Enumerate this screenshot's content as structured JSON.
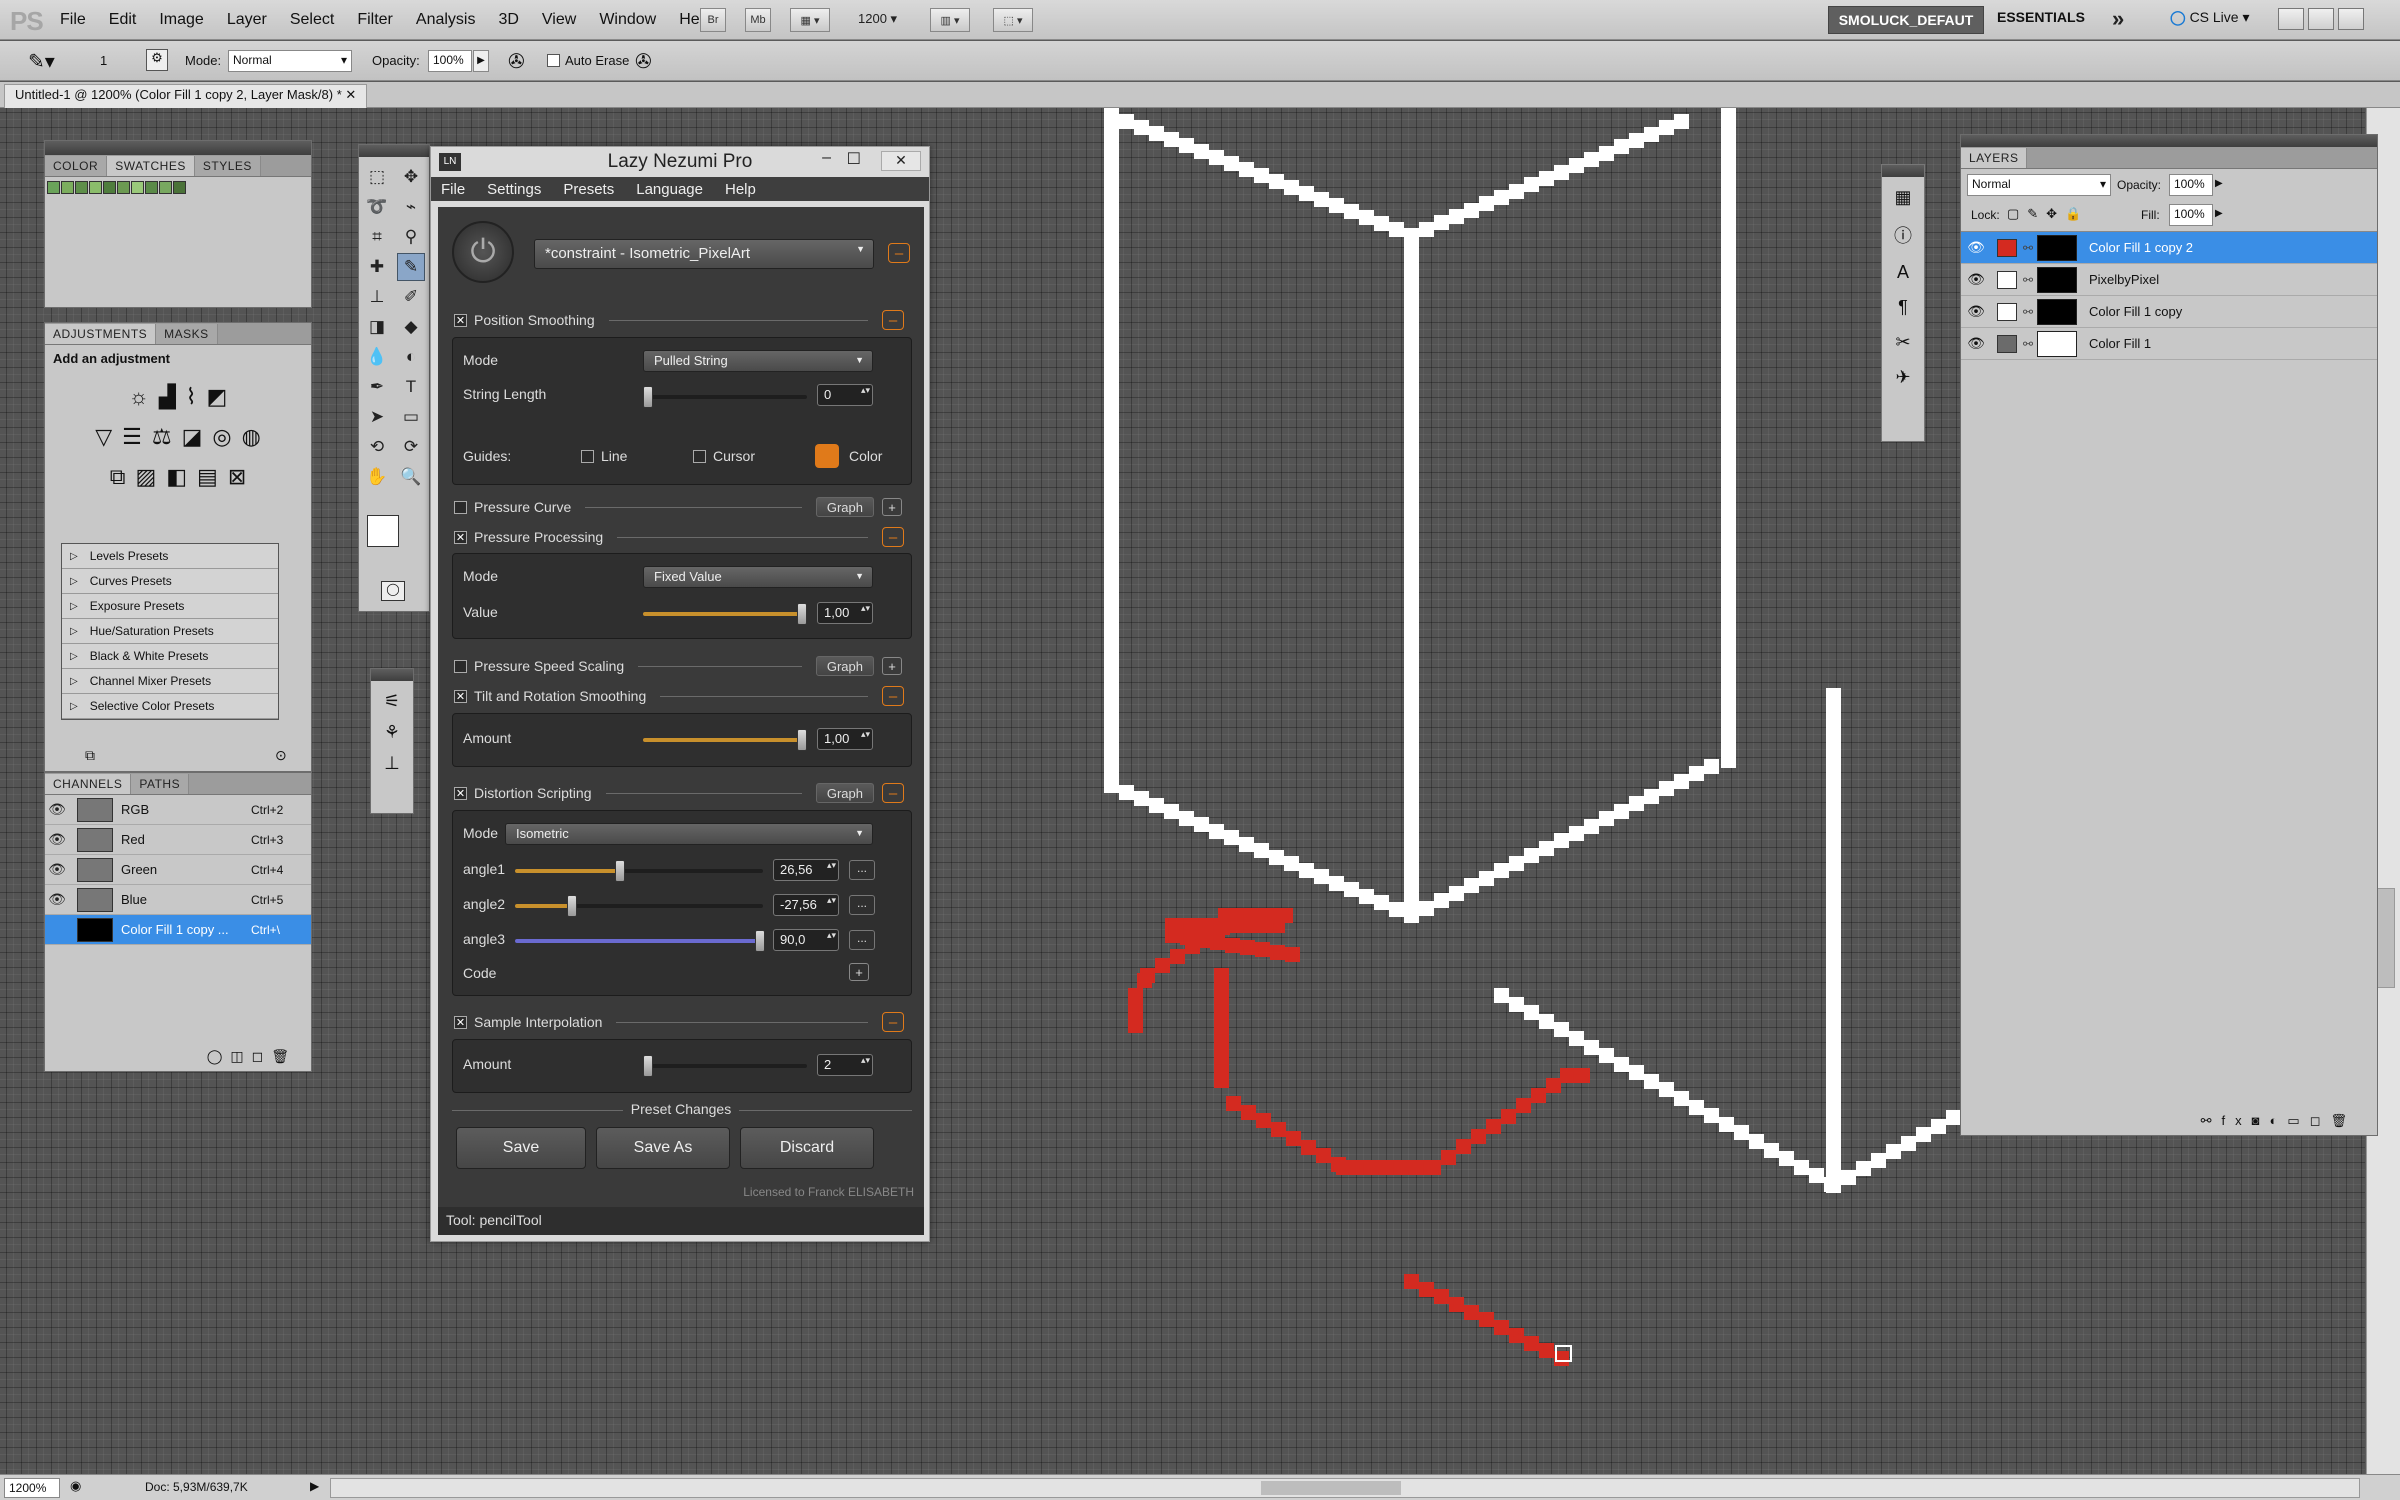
{
  "app": {
    "logo": "PS"
  },
  "menu": [
    "File",
    "Edit",
    "Image",
    "Layer",
    "Select",
    "Filter",
    "Analysis",
    "3D",
    "View",
    "Window",
    "Help"
  ],
  "appbar": {
    "bridge": "Br",
    "minibridge": "Mb",
    "zoom": "1200",
    "workspace_active": "SMOLUCK_DEFAUT",
    "workspace": "ESSENTIALS",
    "more": "»",
    "cslive": "CS Live"
  },
  "options": {
    "brush_size": "1",
    "mode_label": "Mode:",
    "mode_value": "Normal",
    "opacity_label": "Opacity:",
    "opacity_value": "100%",
    "auto_erase": "Auto Erase"
  },
  "document": {
    "tab": "Untitled-1 @ 1200% (Color Fill 1 copy 2, Layer Mask/8) *",
    "zoom_status": "1200%",
    "doc_status": "Doc: 5,93M/639,7K"
  },
  "color_panel": {
    "tabs": [
      "COLOR",
      "SWATCHES",
      "STYLES"
    ],
    "swatches": [
      "#6aa35a",
      "#7cae5e",
      "#5e8f4a",
      "#8bbd6b",
      "#4f7d3d",
      "#6c9a52",
      "#9ac97a",
      "#5a8a48",
      "#78a860",
      "#4a7238"
    ]
  },
  "adjustments": {
    "tabs": [
      "ADJUSTMENTS",
      "MASKS"
    ],
    "heading": "Add an adjustment",
    "presets": [
      "Levels Presets",
      "Curves Presets",
      "Exposure Presets",
      "Hue/Saturation Presets",
      "Black & White Presets",
      "Channel Mixer Presets",
      "Selective Color Presets"
    ]
  },
  "channels": {
    "tabs": [
      "CHANNELS",
      "PATHS"
    ],
    "rows": [
      {
        "name": "RGB",
        "shortcut": "Ctrl+2"
      },
      {
        "name": "Red",
        "shortcut": "Ctrl+3"
      },
      {
        "name": "Green",
        "shortcut": "Ctrl+4"
      },
      {
        "name": "Blue",
        "shortcut": "Ctrl+5"
      },
      {
        "name": "Color Fill 1 copy ...",
        "shortcut": "Ctrl+\\"
      }
    ]
  },
  "layers": {
    "tab": "LAYERS",
    "blend": "Normal",
    "opacity_label": "Opacity:",
    "opacity": "100%",
    "lock_label": "Lock:",
    "fill_label": "Fill:",
    "fill": "100%",
    "rows": [
      {
        "name": "Color Fill 1 copy 2",
        "swatch": "#d42a20",
        "mask": "#000000"
      },
      {
        "name": "PixelbyPixel",
        "swatch": "#ffffff",
        "mask": "#000000"
      },
      {
        "name": "Color Fill 1 copy",
        "swatch": "#ffffff",
        "mask": "#000000"
      },
      {
        "name": "Color Fill 1",
        "swatch": "#6b6b6b",
        "mask": "#ffffff"
      }
    ]
  },
  "lazy_nezumi": {
    "logo": "LN",
    "title": "Lazy Nezumi Pro",
    "menu": [
      "File",
      "Settings",
      "Presets",
      "Language",
      "Help"
    ],
    "preset": "*constraint - Isometric_PixelArt",
    "position_smoothing": {
      "label": "Position Smoothing",
      "mode_label": "Mode",
      "mode": "Pulled String",
      "string_label": "String Length",
      "string_value": "0",
      "guides_label": "Guides:",
      "guide_line": "Line",
      "guide_cursor": "Cursor",
      "guide_color": "Color"
    },
    "pressure_curve": {
      "label": "Pressure Curve",
      "graph": "Graph"
    },
    "pressure_processing": {
      "label": "Pressure Processing",
      "mode_label": "Mode",
      "mode": "Fixed Value",
      "value_label": "Value",
      "value": "1,00"
    },
    "pressure_speed": {
      "label": "Pressure Speed Scaling",
      "graph": "Graph"
    },
    "tilt": {
      "label": "Tilt and Rotation Smoothing",
      "amount_label": "Amount",
      "amount": "1,00"
    },
    "distortion": {
      "label": "Distortion Scripting",
      "graph": "Graph",
      "mode_label": "Mode",
      "mode": "Isometric",
      "angle1_label": "angle1",
      "angle1": "26,56",
      "angle2_label": "angle2",
      "angle2": "-27,56",
      "angle3_label": "angle3",
      "angle3": "90,0",
      "code_label": "Code"
    },
    "sample": {
      "label": "Sample Interpolation",
      "amount_label": "Amount",
      "amount": "2"
    },
    "preset_changes": "Preset Changes",
    "save": "Save",
    "save_as": "Save As",
    "discard": "Discard",
    "license": "Licensed to Franck ELISABETH",
    "status": "Tool: pencilTool"
  },
  "colors": {
    "accent": "#e07a1a",
    "selection": "#3a8ee6",
    "stroke_white": "#ffffff",
    "stroke_red": "#d42a20"
  }
}
